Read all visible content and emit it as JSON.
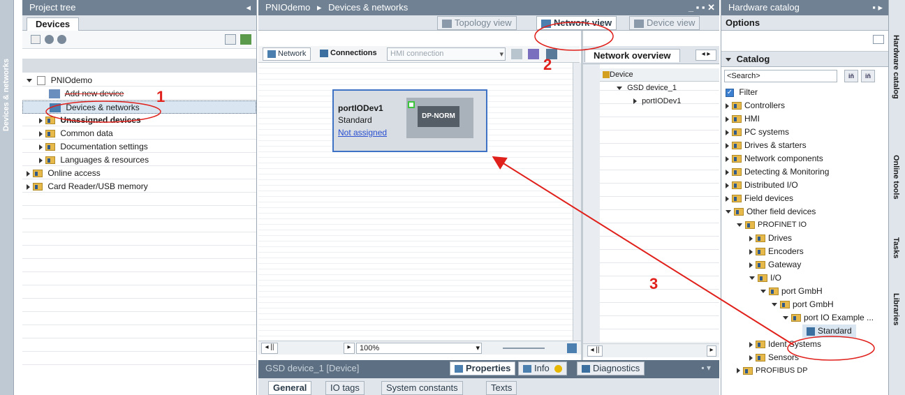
{
  "left_strip": {
    "label": "Devices & networks"
  },
  "project_tree": {
    "title": "Project tree",
    "tab": "Devices",
    "items": [
      {
        "label": "PNIOdemo",
        "expanded": true,
        "level": 0
      },
      {
        "label": "Add new device",
        "level": 1
      },
      {
        "label": "Devices & networks",
        "level": 1
      },
      {
        "label": "Unassigned devices",
        "level": 1
      },
      {
        "label": "Common data",
        "level": 1
      },
      {
        "label": "Documentation settings",
        "level": 1
      },
      {
        "label": "Languages & resources",
        "level": 1
      },
      {
        "label": "Online access",
        "level": 0
      },
      {
        "label": "Card Reader/USB memory",
        "level": 0
      }
    ]
  },
  "editor": {
    "breadcrumb_project": "PNIOdemo",
    "breadcrumb_sep": "▸",
    "breadcrumb_page": "Devices & networks",
    "view_tabs": [
      "Topology view",
      "Network view",
      "Device view"
    ],
    "toolbar": {
      "network": "Network",
      "connections": "Connections",
      "connection_type": "HMI connection"
    },
    "device": {
      "name": "portIODev1",
      "type": "Standard",
      "link": "Not assigned",
      "module": "DP-NORM"
    },
    "zoom": "100%"
  },
  "network_overview": {
    "tab": "Network overview",
    "header": "Device",
    "rows": [
      "GSD device_1",
      "portIODev1"
    ]
  },
  "properties_panel": {
    "title": "GSD device_1 [Device]",
    "buttons": [
      "Properties",
      "Info",
      "Diagnostics"
    ],
    "tabs": [
      "General",
      "IO tags",
      "System constants",
      "Texts"
    ]
  },
  "hardware_catalog": {
    "title": "Hardware catalog",
    "options_label": "Options",
    "catalog_label": "Catalog",
    "search_placeholder": "<Search>",
    "filter_label": "Filter",
    "items": [
      {
        "label": "Controllers",
        "level": 0
      },
      {
        "label": "HMI",
        "level": 0
      },
      {
        "label": "PC systems",
        "level": 0
      },
      {
        "label": "Drives & starters",
        "level": 0
      },
      {
        "label": "Network components",
        "level": 0
      },
      {
        "label": "Detecting & Monitoring",
        "level": 0
      },
      {
        "label": "Distributed I/O",
        "level": 0
      },
      {
        "label": "Field devices",
        "level": 0
      },
      {
        "label": "Other field devices",
        "level": 0
      },
      {
        "label": "PROFINET IO",
        "level": 1
      },
      {
        "label": "Drives",
        "level": 2
      },
      {
        "label": "Encoders",
        "level": 2
      },
      {
        "label": "Gateway",
        "level": 2
      },
      {
        "label": "I/O",
        "level": 2
      },
      {
        "label": "port GmbH",
        "level": 3
      },
      {
        "label": "port GmbH",
        "level": 4
      },
      {
        "label": "port IO Example ...",
        "level": 5
      },
      {
        "label": "Standard",
        "level": 6
      },
      {
        "label": "Ident Systems",
        "level": 2
      },
      {
        "label": "Sensors",
        "level": 2
      },
      {
        "label": "PROFIBUS DP",
        "level": 1
      }
    ]
  },
  "right_strip": [
    "Hardware catalog",
    "Online tools",
    "Tasks",
    "Libraries"
  ],
  "annotations": [
    "1",
    "2",
    "3"
  ],
  "colors": {
    "annotation": "#e0201b",
    "title_bar": "#6f8193",
    "selected": "#d9e6f2"
  }
}
